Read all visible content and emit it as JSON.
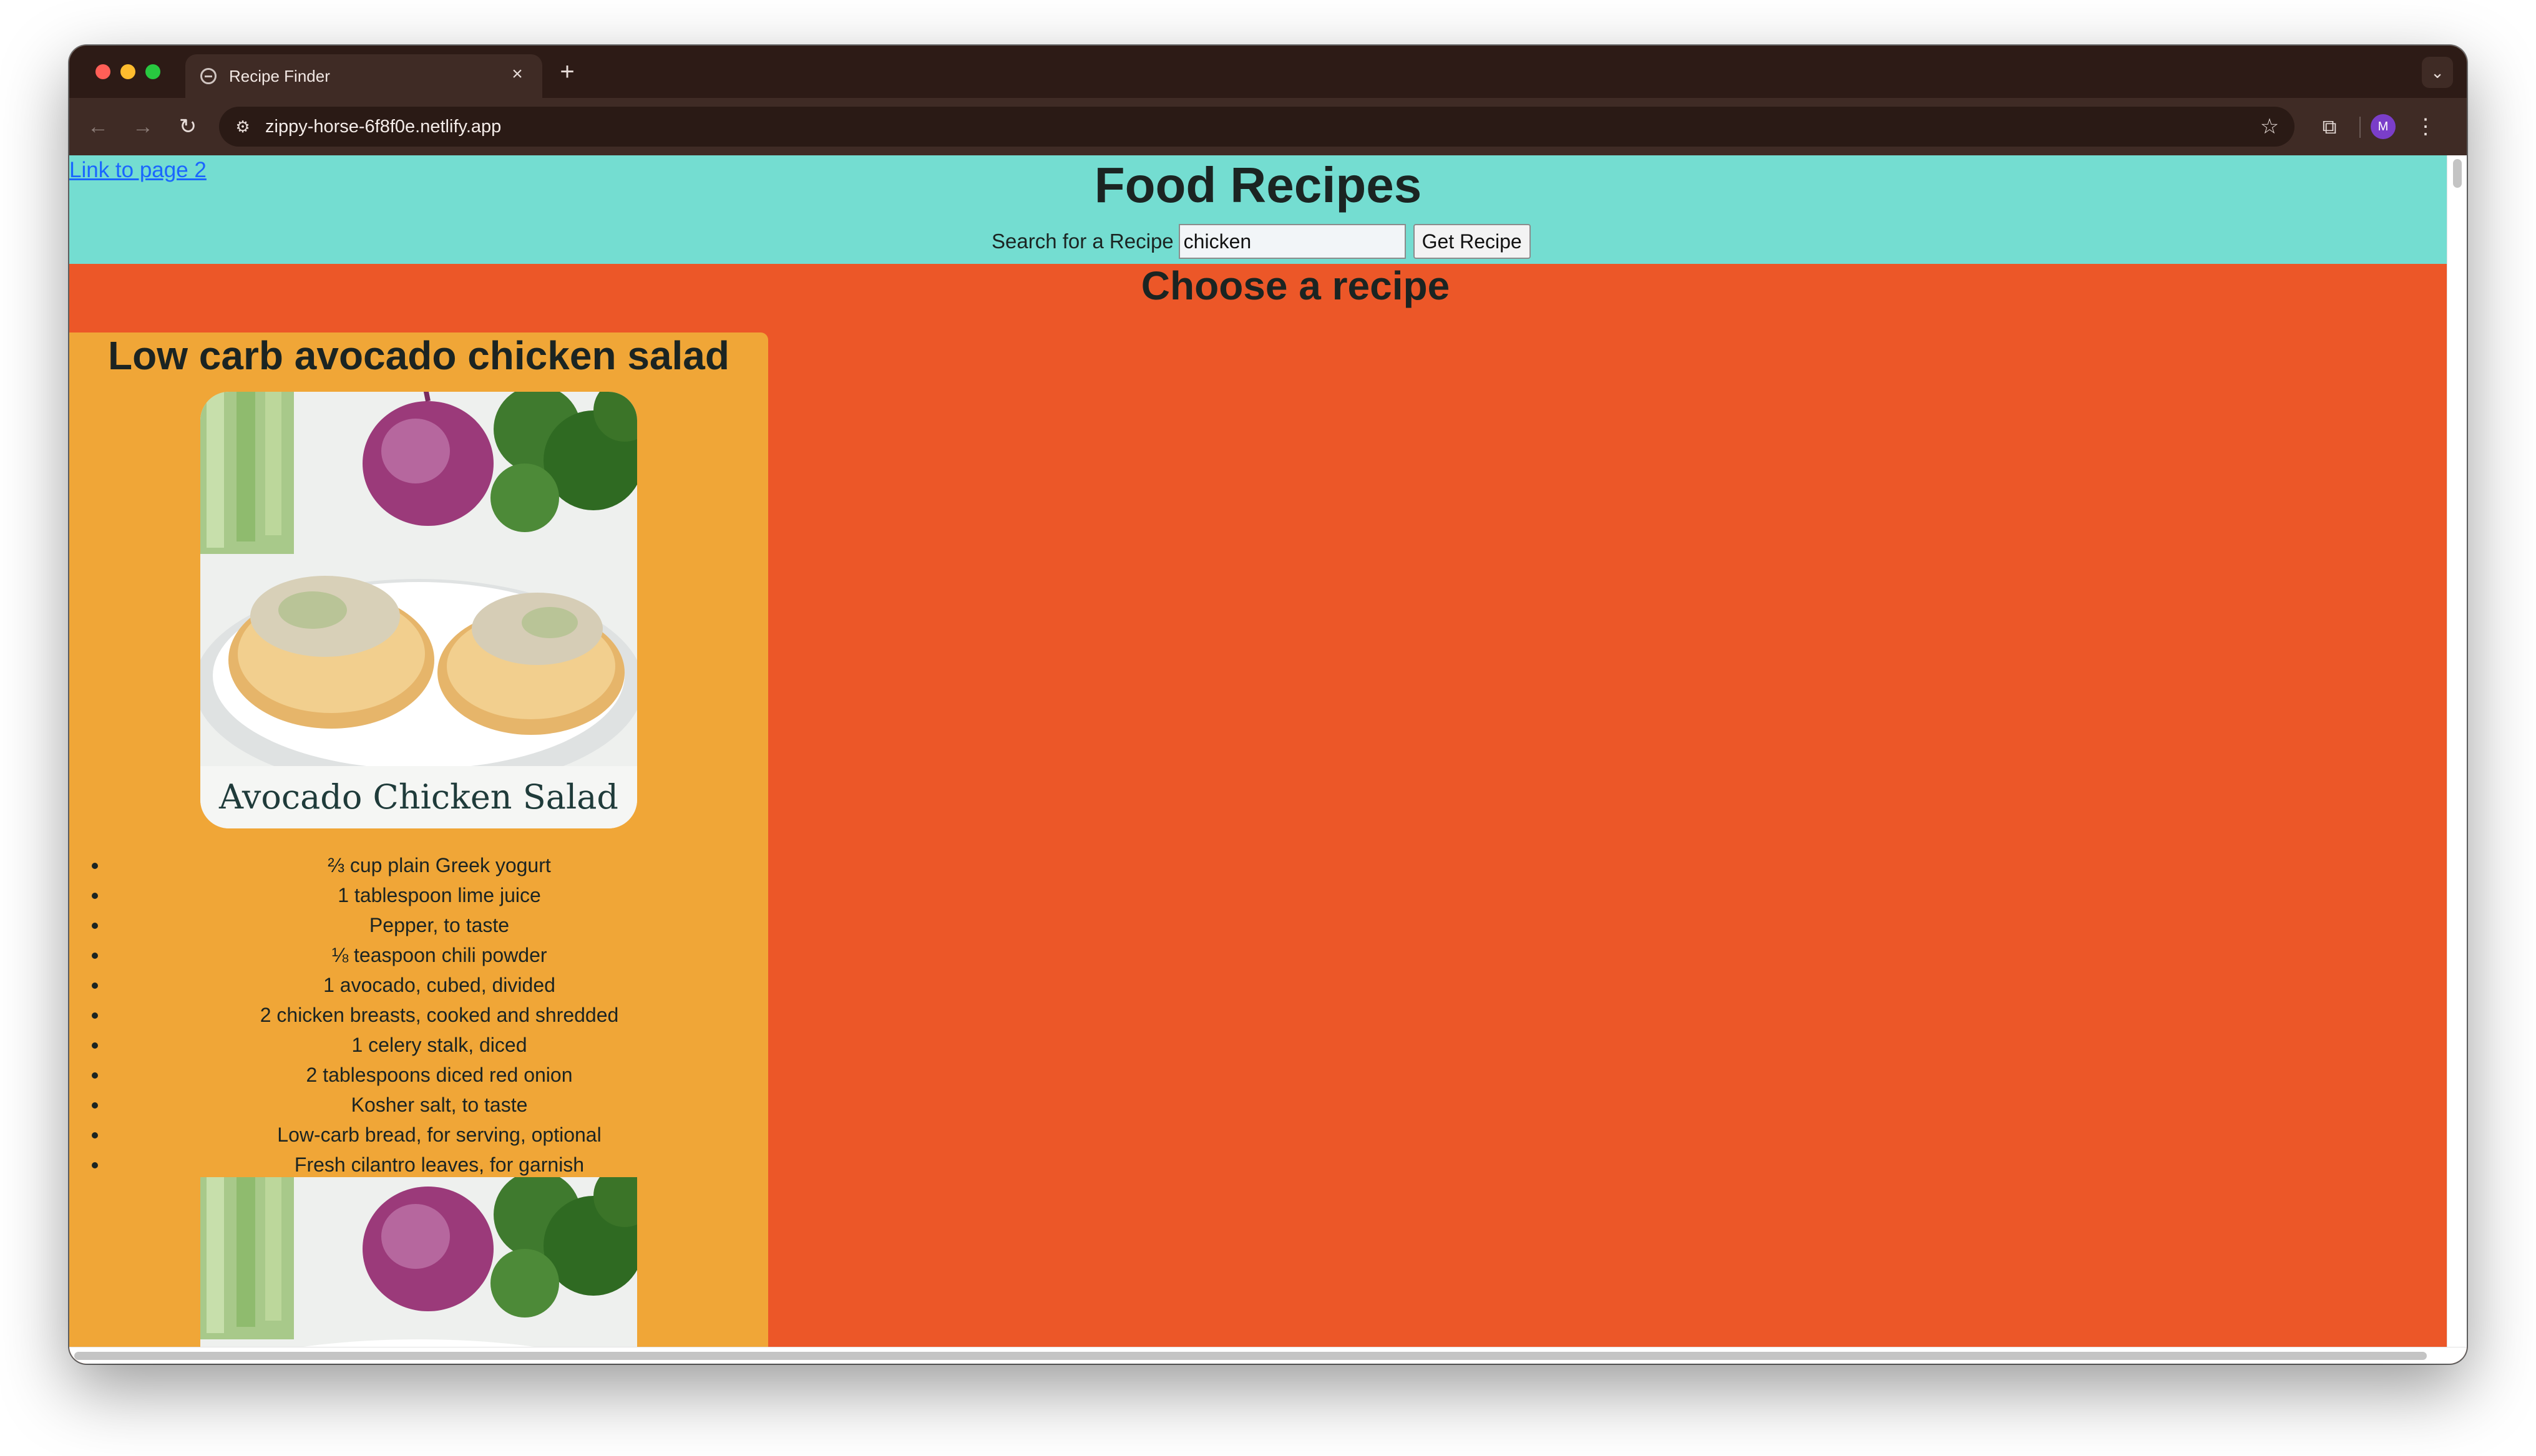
{
  "browser": {
    "tab_title": "Recipe Finder",
    "url": "zippy-horse-6f8f0e.netlify.app",
    "avatar_initial": "M"
  },
  "page": {
    "link_text": "Link to page 2",
    "title": "Food Recipes",
    "search_label": "Search for a Recipe",
    "search_value": "chicken",
    "search_button": "Get Recipe",
    "section_title": "Choose a recipe"
  },
  "recipe": {
    "title": "Low carb avocado chicken salad",
    "image_caption": "Avocado Chicken Salad",
    "ingredients": [
      "⅔ cup plain Greek yogurt",
      "1 tablespoon lime juice",
      "Pepper, to taste",
      "⅛ teaspoon chili powder",
      "1 avocado, cubed, divided",
      "2 chicken breasts, cooked and shredded",
      "1 celery stalk, diced",
      "2 tablespoons diced red onion",
      "Kosher salt, to taste",
      "Low-carb bread, for serving, optional",
      "Fresh cilantro leaves, for garnish"
    ]
  },
  "colors": {
    "header_bg": "#74ddd1",
    "page_bg": "#ec5728",
    "card_bg": "#f0a637",
    "link": "#1a66ff"
  }
}
